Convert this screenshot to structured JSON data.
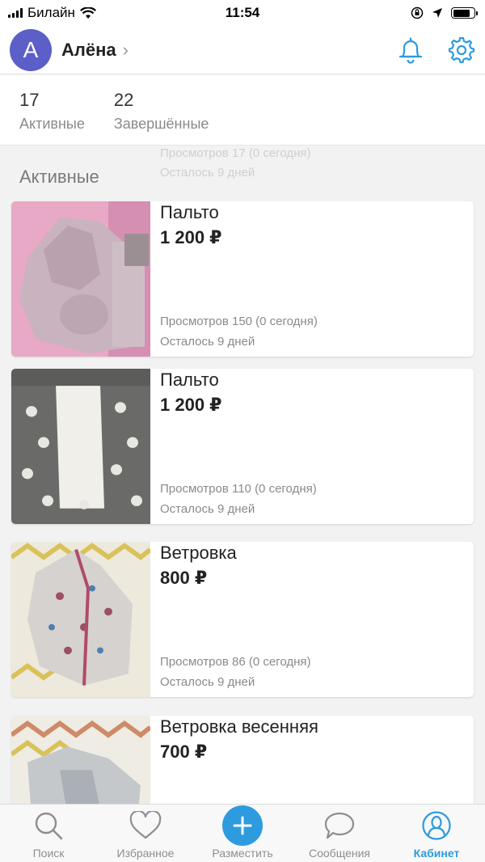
{
  "status_bar": {
    "carrier": "Билайн",
    "time": "11:54",
    "battery_level": 0.8
  },
  "profile": {
    "avatar_letter": "А",
    "name": "Алёна",
    "chevron": "›"
  },
  "stats": [
    {
      "count": "17",
      "label": "Активные"
    },
    {
      "count": "22",
      "label": "Завершённые"
    }
  ],
  "section_title": "Активные",
  "ghost_text": {
    "views": "Просмотров 17 (0 сегодня)",
    "left": "Осталось 9 дней"
  },
  "listings": [
    {
      "title": "Пальто",
      "price": "1 200 ₽",
      "views": "Просмотров 150 (0 сегодня)",
      "remaining": "Осталось 9 дней",
      "photo": "pink-coat-photo"
    },
    {
      "title": "Пальто",
      "price": "1 200 ₽",
      "views": "Просмотров 110 (0 сегодня)",
      "remaining": "Осталось 9 дней",
      "photo": "grey-star-coat-photo"
    },
    {
      "title": "Ветровка",
      "price": "800 ₽",
      "views": "Просмотров 86 (0 сегодня)",
      "remaining": "Осталось 9 дней",
      "photo": "printed-windbreaker-photo"
    },
    {
      "title": "Ветровка весенняя",
      "price": "700 ₽",
      "views": "",
      "remaining": "",
      "photo": "spring-windbreaker-photo"
    }
  ],
  "tabs": [
    {
      "label": "Поиск",
      "icon": "search-icon",
      "active": false
    },
    {
      "label": "Избранное",
      "icon": "heart-icon",
      "active": false
    },
    {
      "label": "Разместить",
      "icon": "plus-icon",
      "active": false
    },
    {
      "label": "Сообщения",
      "icon": "chat-bubble-icon",
      "active": false
    },
    {
      "label": "Кабинет",
      "icon": "profile-icon",
      "active": true
    }
  ],
  "colors": {
    "accent": "#2d9bde",
    "avatar_bg": "#5b5fc7",
    "background": "#f2f2f2"
  }
}
